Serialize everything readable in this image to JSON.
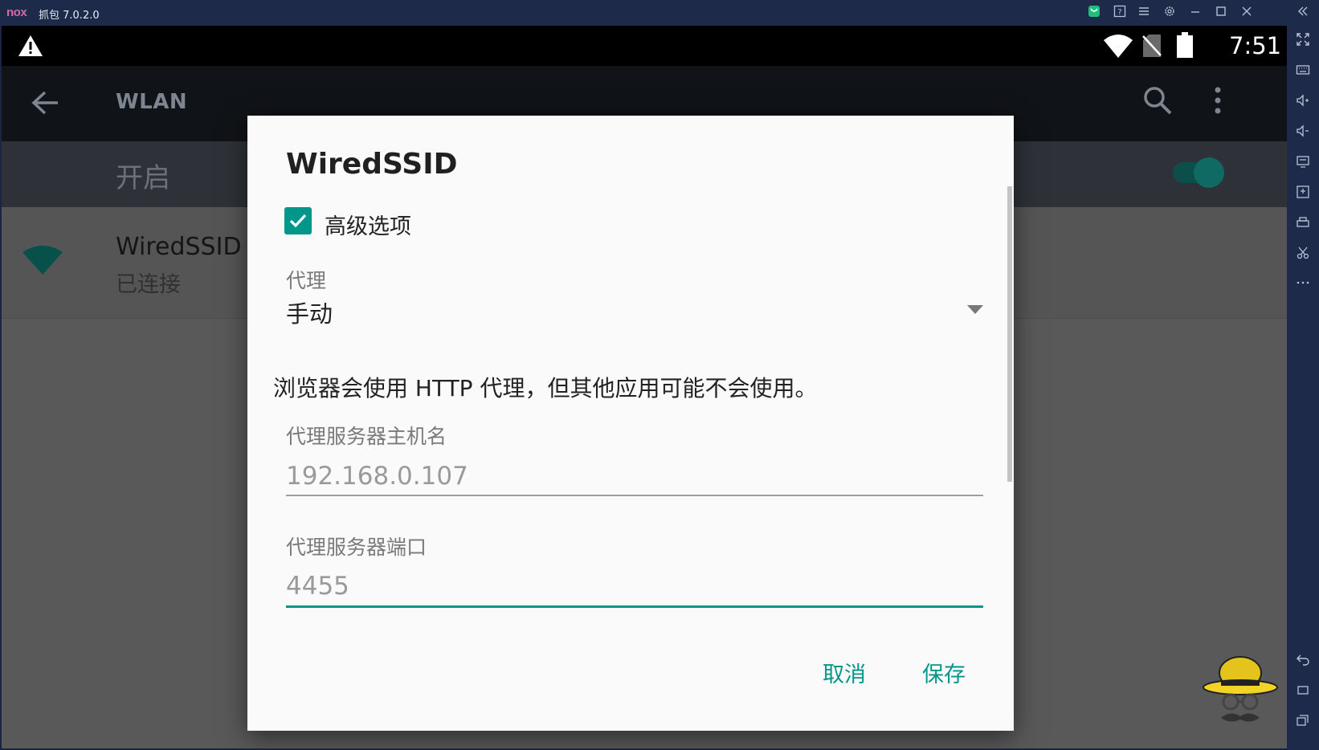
{
  "window": {
    "logo": "nox",
    "title": "抓包 7.0.2.0",
    "icons": [
      "shop-icon",
      "help-icon",
      "menu-icon",
      "settings-icon",
      "minimize-icon",
      "maximize-icon",
      "close-icon",
      "collapse-icon"
    ]
  },
  "statusbar": {
    "time": "7:51",
    "icons": [
      "warning-icon",
      "wifi-icon",
      "no-sim-icon",
      "battery-icon"
    ]
  },
  "appbar": {
    "title": "WLAN"
  },
  "switch_row": {
    "label": "开启",
    "enabled": true
  },
  "network": {
    "ssid": "WiredSSID",
    "status": "已连接"
  },
  "dialog": {
    "title": "WiredSSID",
    "advanced_label": "高级选项",
    "advanced_checked": true,
    "proxy_caption": "代理",
    "proxy_value": "手动",
    "notice": "浏览器会使用 HTTP 代理，但其他应用可能不会使用。",
    "host_caption": "代理服务器主机名",
    "host_value": "192.168.0.107",
    "port_caption": "代理服务器端口",
    "port_value": "4455",
    "cancel_label": "取消",
    "save_label": "保存"
  },
  "sidebar_icons": [
    "fullscreen-icon",
    "keyboard-icon",
    "volume-up-icon",
    "volume-down-icon",
    "screen-icon",
    "add-apk-icon",
    "print-icon",
    "scissors-icon",
    "more-icon",
    "back-icon",
    "home-icon",
    "recent-apps-icon"
  ],
  "colors": {
    "accent": "#00968a",
    "titlebar": "#1e2a4a",
    "dialog_bg": "#fafafa"
  }
}
